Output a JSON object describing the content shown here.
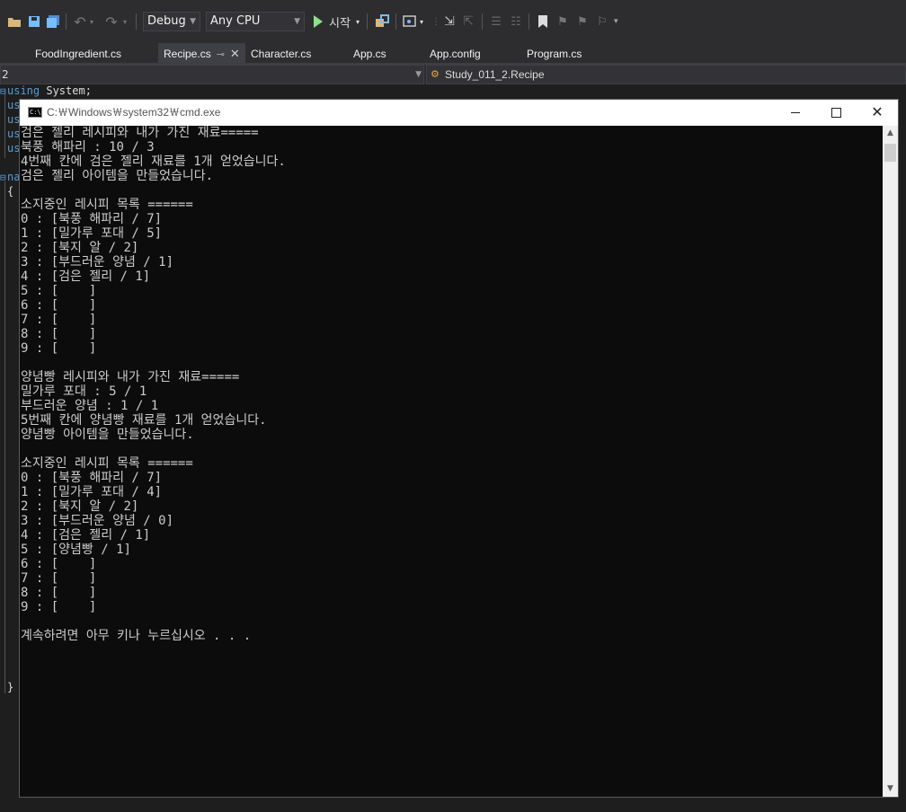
{
  "toolbar": {
    "config": "Debug",
    "platform": "Any CPU",
    "start_label": "시작"
  },
  "tabs": [
    {
      "label": "FoodIngredient.cs"
    },
    {
      "label": "Recipe.cs",
      "active": true
    },
    {
      "label": "Character.cs"
    },
    {
      "label": "App.cs"
    },
    {
      "label": "App.config"
    },
    {
      "label": "Program.cs"
    }
  ],
  "navbar": {
    "project": "2",
    "member": "Study_011_2.Recipe"
  },
  "editor": {
    "line1_keyword": "using",
    "line1_rest": " System;",
    "partial": [
      "us",
      "us",
      "us",
      "us"
    ],
    "ns_partial": "na",
    "brace_open": "{",
    "brace_close": "}"
  },
  "cmd": {
    "title": "C:￦Windows￦system32￦cmd.exe",
    "lines": [
      "검은 젤리 레시피와 내가 가진 재료=====",
      "북풍 해파리 : 10 / 3",
      "4번째 칸에 검은 젤리 재료를 1개 얻었습니다.",
      "검은 젤리 아이템을 만들었습니다.",
      "",
      "소지중인 레시피 목록 ======",
      "0 : [북풍 해파리 / 7]",
      "1 : [밀가루 포대 / 5]",
      "2 : [북지 알 / 2]",
      "3 : [부드러운 양념 / 1]",
      "4 : [검은 젤리 / 1]",
      "5 : [    ]",
      "6 : [    ]",
      "7 : [    ]",
      "8 : [    ]",
      "9 : [    ]",
      "",
      "양념빵 레시피와 내가 가진 재료=====",
      "밀가루 포대 : 5 / 1",
      "부드러운 양념 : 1 / 1",
      "5번째 칸에 양념빵 재료를 1개 얻었습니다.",
      "양념빵 아이템을 만들었습니다.",
      "",
      "소지중인 레시피 목록 ======",
      "0 : [북풍 해파리 / 7]",
      "1 : [밀가루 포대 / 4]",
      "2 : [북지 알 / 2]",
      "3 : [부드러운 양념 / 0]",
      "4 : [검은 젤리 / 1]",
      "5 : [양념빵 / 1]",
      "6 : [    ]",
      "7 : [    ]",
      "8 : [    ]",
      "9 : [    ]",
      "",
      "계속하려면 아무 키나 누르십시오 . . ."
    ]
  }
}
